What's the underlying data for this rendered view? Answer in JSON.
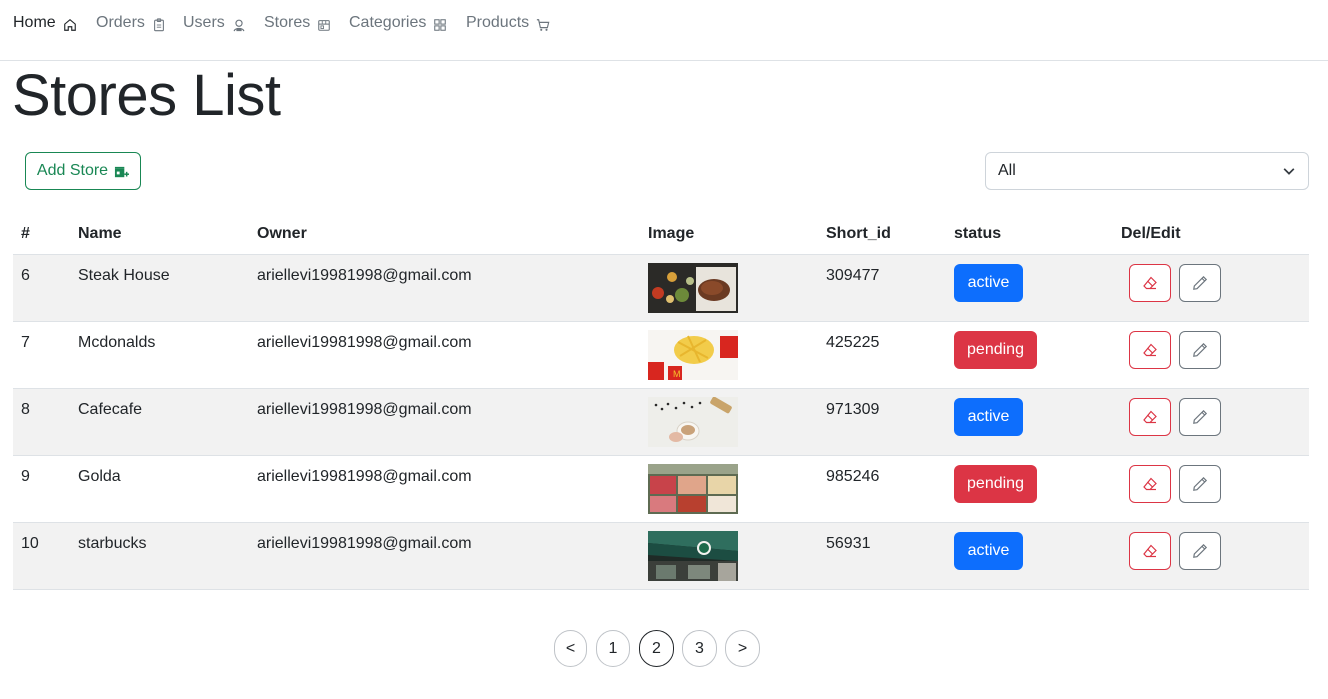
{
  "nav": {
    "items": [
      {
        "label": "Home",
        "icon": "home-icon",
        "active": true
      },
      {
        "label": "Orders",
        "icon": "clipboard-icon",
        "active": false
      },
      {
        "label": "Users",
        "icon": "person-badge-icon",
        "active": false
      },
      {
        "label": "Stores",
        "icon": "shop-window-icon",
        "active": false
      },
      {
        "label": "Categories",
        "icon": "grid-icon",
        "active": false
      },
      {
        "label": "Products",
        "icon": "cart-icon",
        "active": false
      }
    ]
  },
  "page": {
    "title": "Stores List"
  },
  "toolbar": {
    "add_label": "Add Store",
    "filter_value": "All"
  },
  "table": {
    "headers": [
      "#",
      "Name",
      "Owner",
      "Image",
      "Short_id",
      "status",
      "Del/Edit"
    ],
    "rows": [
      {
        "id": "6",
        "name": "Steak House",
        "owner": "ariellevi19981998@gmail.com",
        "image": "steak-photo",
        "short_id": "309477",
        "status": "active"
      },
      {
        "id": "7",
        "name": "Mcdonalds",
        "owner": "ariellevi19981998@gmail.com",
        "image": "fries-photo",
        "short_id": "425225",
        "status": "pending"
      },
      {
        "id": "8",
        "name": "Cafecafe",
        "owner": "ariellevi19981998@gmail.com",
        "image": "coffee-photo",
        "short_id": "971309",
        "status": "active"
      },
      {
        "id": "9",
        "name": "Golda",
        "owner": "ariellevi19981998@gmail.com",
        "image": "ice-cream-photo",
        "short_id": "985246",
        "status": "pending"
      },
      {
        "id": "10",
        "name": "starbucks",
        "owner": "ariellevi19981998@gmail.com",
        "image": "starbucks-storefront-photo",
        "short_id": "56931",
        "status": "active"
      }
    ]
  },
  "pagination": {
    "prev": "<",
    "pages": [
      "1",
      "2",
      "3"
    ],
    "current": "2",
    "next": ">"
  },
  "colors": {
    "primary": "#0d6efd",
    "danger": "#dc3545",
    "success": "#198754",
    "secondary": "#6c757d"
  }
}
